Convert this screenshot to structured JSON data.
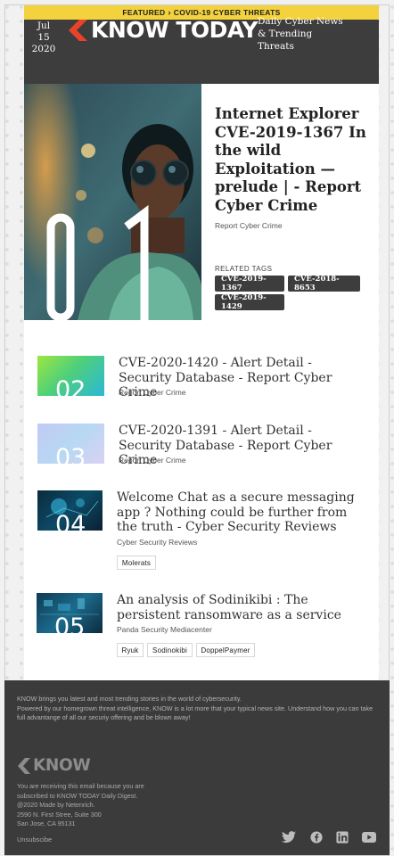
{
  "featured": {
    "label": "FEATURED",
    "section": "COVID-19 CYBER THREATS"
  },
  "header": {
    "date_day": "Jul 15",
    "date_year": "2020",
    "logo_text": "KNOW TODAY",
    "tagline": "Daily Cyber News & Trending Threats"
  },
  "hero": {
    "number": "01",
    "title": "Internet Explorer CVE-2019-1367 In the wild Exploitation — prelude | - Report Cyber Crime",
    "source": "Report Cyber Crime",
    "related_label": "RELATED TAGS",
    "tags": [
      "CVE-2019-1367",
      "CVE-2018-8653",
      "CVE-2019-1429"
    ]
  },
  "stories": [
    {
      "number": "02",
      "title": "CVE-2020-1420 - Alert Detail - Security Database - Report Cyber Crime",
      "source": "Report Cyber Crime",
      "tags": []
    },
    {
      "number": "03",
      "title": "CVE-2020-1391 - Alert Detail - Security Database - Report Cyber Crime",
      "source": "Report Cyber Crime",
      "tags": []
    },
    {
      "number": "04",
      "title": "Welcome Chat as a secure messaging app ? Nothing could be further from the truth - Cyber Security Reviews",
      "source": "Cyber Security Reviews",
      "tags": [
        "Molerats"
      ]
    },
    {
      "number": "05",
      "title": "An analysis of Sodinikibi : The persistent ransomware as a service",
      "source": "Panda Security Mediacenter",
      "tags": [
        "Ryuk",
        "Sodinokibi",
        "DoppelPaymer"
      ]
    }
  ],
  "footer": {
    "intro_1": "KNOW brings you latest and most trending stories in the world of cybersecurity.",
    "intro_2": "Powered by our homegrown threat intelligence, KNOW is a lot more that your typical news site. Understand how you can take full advantange of all our securiy offering and be blown away!",
    "logo_text": "KNOW",
    "notice_1": "You are receiving this email because you are",
    "notice_2": "subscribed to KNOW TODAY Daily Digest.",
    "made_by": "@2020 Made by Netenrich.",
    "address_1": "2590 N. First Stree, Suite 300",
    "address_2": "San Jose, CA 95131",
    "unsubscribe": "Unsubscibe",
    "social_icons": [
      "twitter-icon",
      "facebook-icon",
      "linkedin-icon",
      "youtube-icon"
    ]
  },
  "colors": {
    "featured_bar": "#f3d23e",
    "header_bg": "#3d3d3d",
    "brand_red": "#e8432a",
    "footer_bg": "#3b3b3b"
  }
}
